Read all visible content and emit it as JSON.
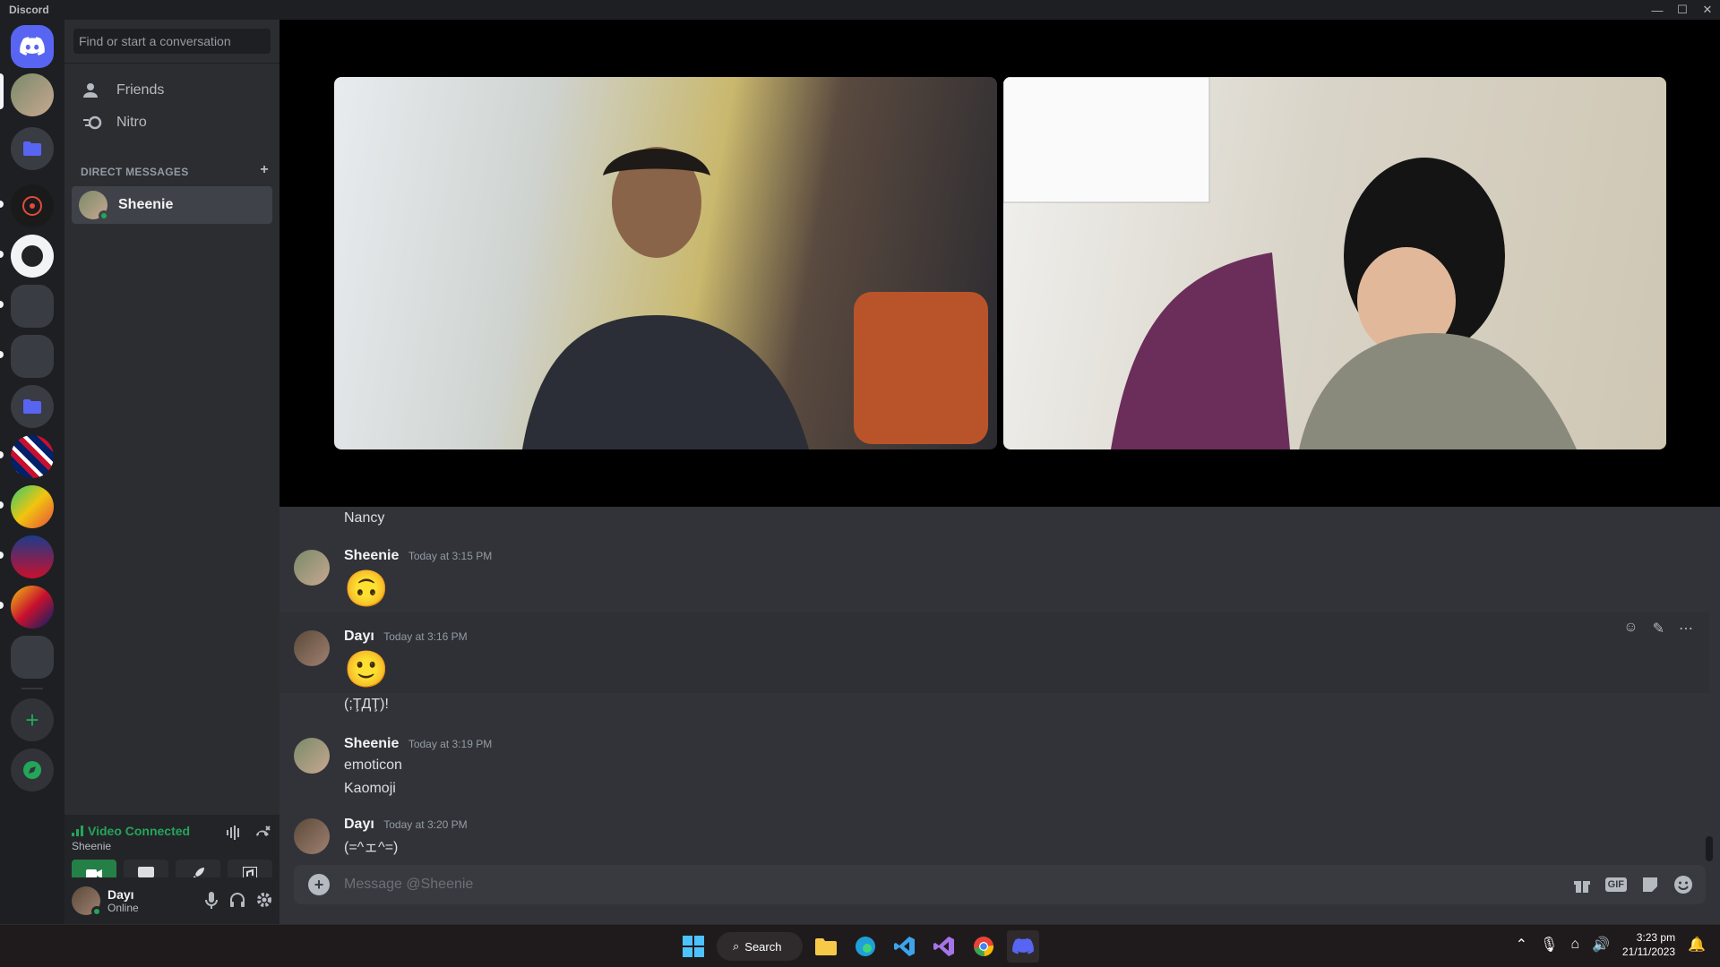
{
  "window": {
    "title": "Discord",
    "min": "—",
    "max": "☐",
    "close": "✕"
  },
  "search": {
    "placeholder": "Find or start a conversation"
  },
  "nav": {
    "friends": "Friends",
    "nitro": "Nitro"
  },
  "dm": {
    "header": "DIRECT MESSAGES",
    "add": "+",
    "items": [
      {
        "name": "Sheenie",
        "status": "online"
      }
    ]
  },
  "voice": {
    "status": "Video Connected",
    "channel": "Sheenie"
  },
  "user": {
    "name": "Dayı",
    "status": "Online"
  },
  "chat": {
    "top_line": "Nancy",
    "messages": [
      {
        "author": "Sheenie",
        "time": "Today at 3:15 PM",
        "lines": [
          "🙃"
        ]
      },
      {
        "author": "Dayı",
        "time": "Today at 3:16 PM",
        "lines": [
          "🙂",
          "(;ŢДŢ)!"
        ]
      },
      {
        "author": "Sheenie",
        "time": "Today at 3:19 PM",
        "lines": [
          "emoticon",
          "Kaomoji"
        ]
      },
      {
        "author": "Dayı",
        "time": "Today at 3:20 PM",
        "lines": [
          "(=^ェ^=)"
        ]
      }
    ],
    "composer_placeholder": "Message @Sheenie"
  },
  "taskbar": {
    "search": "Search",
    "time": "3:23 pm",
    "date": "21/11/2023"
  },
  "colors": {
    "accent": "#5865f2",
    "online": "#23a55a",
    "bg": "#313338"
  }
}
